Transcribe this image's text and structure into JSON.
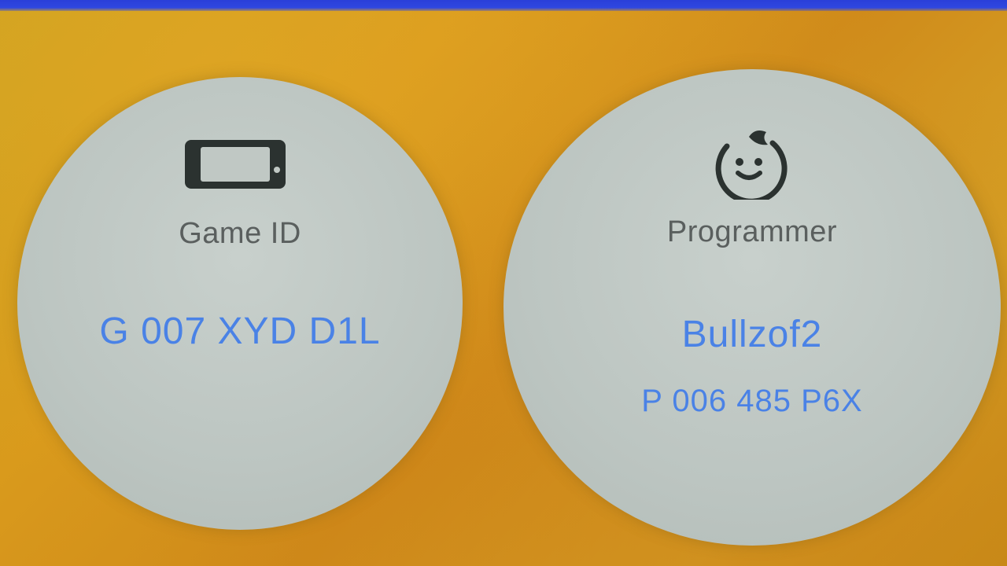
{
  "window": {
    "top_bar_color": "#2f47e0"
  },
  "game_card": {
    "icon": "handheld-console-icon",
    "label": "Game ID",
    "value": "G 007 XYD D1L"
  },
  "programmer_card": {
    "icon": "face-icon",
    "label": "Programmer",
    "name": "Bullzof2",
    "id": "P 006 485 P6X"
  },
  "colors": {
    "label_text": "#5a5f5e",
    "value_text": "#4a82e6",
    "card_bg": "#c0c8c4",
    "background": "#d19a1f"
  }
}
